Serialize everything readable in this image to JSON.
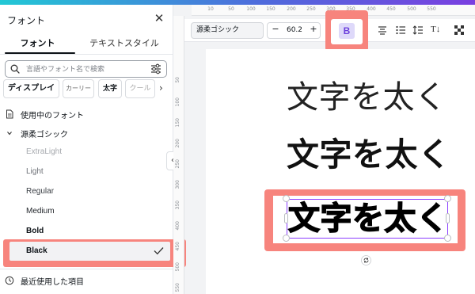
{
  "panel": {
    "title": "フォント",
    "tabs": [
      "フォント",
      "テキストスタイル"
    ],
    "search_placeholder": "言語やフォント名で検索",
    "chips": [
      "ディスプレイ",
      "カーリー",
      "太字",
      "クール"
    ],
    "section_in_use": "使用中のフォント",
    "font_family": "源柔ゴシック",
    "weights": [
      "ExtraLight",
      "Light",
      "Regular",
      "Medium",
      "Bold",
      "Black"
    ],
    "selected_weight": "Black",
    "recent_label": "最近使用した項目"
  },
  "rulers": {
    "top": [
      "10",
      "50",
      "100",
      "150",
      "200",
      "250",
      "300",
      "350",
      "400",
      "450",
      "500",
      "550"
    ],
    "left": [
      "50",
      "100",
      "150",
      "200",
      "250",
      "300",
      "350",
      "400",
      "450",
      "500",
      "550"
    ]
  },
  "toolbar": {
    "font_name": "源柔ゴシック",
    "font_size": "60.2",
    "minus_label": "−",
    "plus_label": "+",
    "bold_label": "B",
    "text_direction_label": "T↓"
  },
  "canvas": {
    "samples": [
      "文字を太く",
      "文字を太く",
      "文字を太く"
    ]
  },
  "colors": {
    "accent": "#8b3dff",
    "highlight": "#f7847d",
    "bold_active_bg": "#ded9fa",
    "bold_active_text": "#6b3fdc"
  },
  "icons": [
    "close-icon",
    "search-icon",
    "filter-icon",
    "chevron-right-icon",
    "document-icon",
    "chevron-down-icon",
    "check-icon",
    "clock-icon",
    "chevron-left-icon",
    "align-center-icon",
    "list-icon",
    "line-spacing-icon",
    "text-direction-icon",
    "transparency-icon",
    "rotate-icon"
  ]
}
